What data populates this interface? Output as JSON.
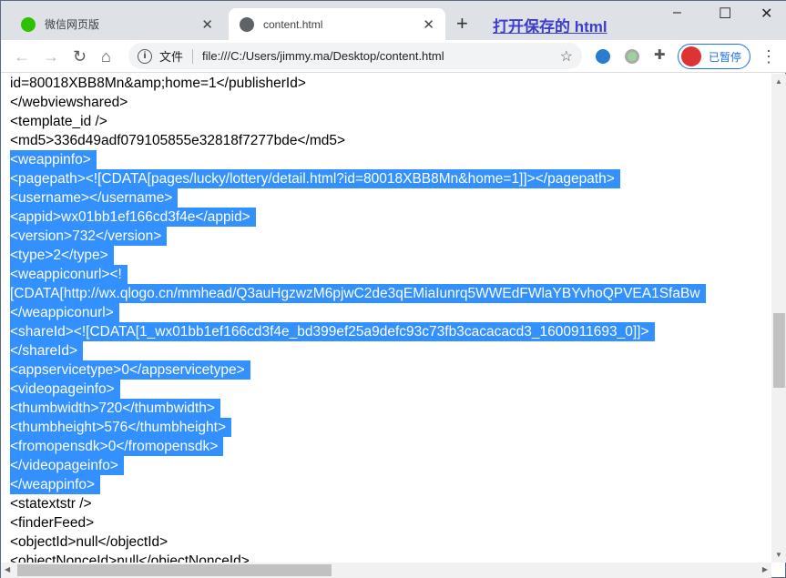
{
  "tabs": [
    {
      "title": "微信网页版",
      "icon": "wechat-icon",
      "color": "#2dc100"
    },
    {
      "title": "content.html",
      "icon": "globe-icon"
    }
  ],
  "save_link": "打开保存的 html",
  "address": {
    "scheme_label": "文件",
    "url": "file:///C:/Users/jimmy.ma/Desktop/content.html"
  },
  "profile": {
    "label": "已暂停"
  },
  "selection_color": "#3390ff",
  "lines": [
    {
      "text": "<weappinfo><pagepath><![CDATA[pages/lucky/lottery/detail.html?",
      "selected": false
    },
    {
      "text": "id=80018XBB8Mn&amp;home=1</publisherId>",
      "selected": false
    },
    {
      "text": "</webviewshared>",
      "selected": false
    },
    {
      "text": "<template_id />",
      "selected": false
    },
    {
      "text": "<md5>336d49adf079105855e32818f7277bde</md5>",
      "selected": false
    },
    {
      "text": "<weappinfo>",
      "selected": true
    },
    {
      "text": "<pagepath><![CDATA[pages/lucky/lottery/detail.html?id=80018XBB8Mn&home=1]]></pagepath>",
      "selected": true
    },
    {
      "text": "<username></username>",
      "selected": true
    },
    {
      "text": "<appid>wx01bb1ef166cd3f4e</appid>",
      "selected": true
    },
    {
      "text": "<version>732</version>",
      "selected": true
    },
    {
      "text": "<type>2</type>",
      "selected": true
    },
    {
      "text": "<weappiconurl><!",
      "selected": true
    },
    {
      "text": "[CDATA[http://wx.qlogo.cn/mmhead/Q3auHgzwzM6pjwC2de3qEMiaIunrq5WWEdFWlaYBYvhoQPVEA1SfaBw",
      "selected": true
    },
    {
      "text": "</weappiconurl>",
      "selected": true
    },
    {
      "text": "<shareId><![CDATA[1_wx01bb1ef166cd3f4e_bd399ef25a9defc93c73fb3cacacacd3_1600911693_0]]>",
      "selected": true
    },
    {
      "text": "</shareId>",
      "selected": true
    },
    {
      "text": "<appservicetype>0</appservicetype>",
      "selected": true
    },
    {
      "text": "<videopageinfo>",
      "selected": true
    },
    {
      "text": "<thumbwidth>720</thumbwidth>",
      "selected": true
    },
    {
      "text": "<thumbheight>576</thumbheight>",
      "selected": true
    },
    {
      "text": "<fromopensdk>0</fromopensdk>",
      "selected": true
    },
    {
      "text": "</videopageinfo>",
      "selected": true
    },
    {
      "text": "</weappinfo>",
      "selected": true
    },
    {
      "text": "<statextstr />",
      "selected": false
    },
    {
      "text": "<finderFeed>",
      "selected": false
    },
    {
      "text": "<objectId>null</objectId>",
      "selected": false
    },
    {
      "text": "<objectNonceId>null</objectNonceId>",
      "selected": false
    }
  ]
}
